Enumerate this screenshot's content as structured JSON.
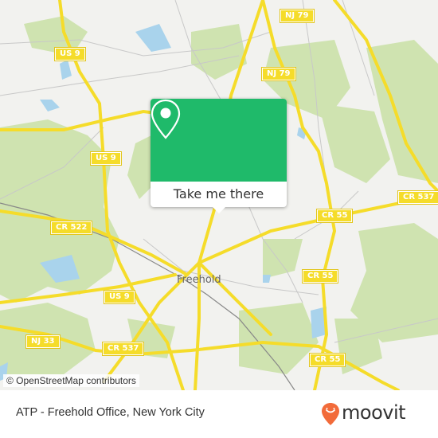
{
  "map": {
    "town_label": "Freehold",
    "attribution": "© OpenStreetMap contributors",
    "road_shields": [
      {
        "label": "US 9"
      },
      {
        "label": "US 9"
      },
      {
        "label": "US 9"
      },
      {
        "label": "NJ 79"
      },
      {
        "label": "NJ 79"
      },
      {
        "label": "CR 537"
      },
      {
        "label": "CR 537"
      },
      {
        "label": "CR 55"
      },
      {
        "label": "CR 55"
      },
      {
        "label": "CR 55"
      },
      {
        "label": "CR 522"
      },
      {
        "label": "NJ 33"
      }
    ],
    "colors": {
      "land": "#f2f2ef",
      "forest": "#cfe3b0",
      "water": "#a9d3ec",
      "road_major": "#f5dc2a",
      "road_minor": "#c8c8c8"
    }
  },
  "popup": {
    "action_label": "Take me there",
    "icon": "map-pin-icon",
    "accent": "#1fba6a"
  },
  "footer": {
    "place_title": "ATP - Freehold Office, New York City",
    "brand": "moovit",
    "brand_color": "#f26b3a"
  }
}
